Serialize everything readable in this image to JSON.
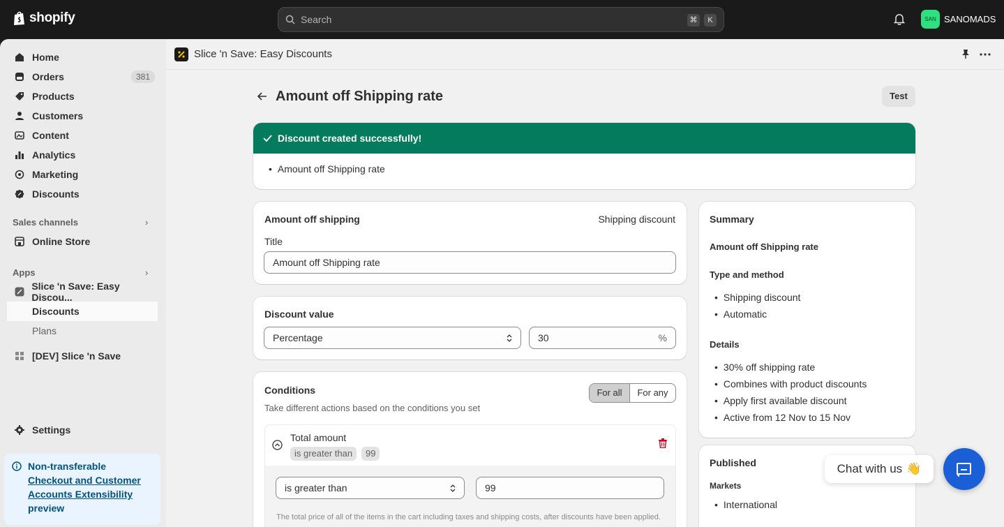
{
  "topbar": {
    "brand": "shopify",
    "search_placeholder": "Search",
    "shortcut_keys": [
      "⌘",
      "K"
    ],
    "store_initials": "SAN",
    "store_name": "SANOMADS"
  },
  "sidebar": {
    "items": [
      {
        "label": "Home",
        "icon": "home-icon"
      },
      {
        "label": "Orders",
        "icon": "orders-icon",
        "badge": "381"
      },
      {
        "label": "Products",
        "icon": "tag-icon"
      },
      {
        "label": "Customers",
        "icon": "person-icon"
      },
      {
        "label": "Content",
        "icon": "content-icon"
      },
      {
        "label": "Analytics",
        "icon": "chart-icon"
      },
      {
        "label": "Marketing",
        "icon": "target-icon"
      },
      {
        "label": "Discounts",
        "icon": "discount-icon"
      }
    ],
    "sales_channels_label": "Sales channels",
    "online_store": "Online Store",
    "apps_label": "Apps",
    "app_name": "Slice 'n Save: Easy Discou...",
    "app_sub_discounts": "Discounts",
    "app_sub_plans": "Plans",
    "dev_app": "[DEV] Slice 'n Save",
    "settings": "Settings",
    "notice": {
      "title": "Non-transferable",
      "link": "Checkout and Customer Accounts Extensibility",
      "suffix": "preview"
    }
  },
  "appbar": {
    "title": "Slice 'n Save: Easy Discounts"
  },
  "page": {
    "title": "Amount off Shipping rate",
    "test_button": "Test",
    "banner": {
      "title": "Discount created successfully!",
      "item": "Amount off Shipping rate"
    },
    "shipping_card": {
      "heading": "Amount off shipping",
      "type": "Shipping discount",
      "title_label": "Title",
      "title_value": "Amount off Shipping rate"
    },
    "value_card": {
      "heading": "Discount value",
      "type_value": "Percentage",
      "amount": "30",
      "suffix": "%"
    },
    "conditions": {
      "heading": "Conditions",
      "description": "Take different actions based on the conditions you set",
      "toggle": [
        "For all",
        "For any"
      ],
      "condition_title": "Total amount",
      "tag_operator": "is greater than",
      "tag_value": "99",
      "operator_value": "is greater than",
      "amount_value": "99",
      "help": "The total price of all of the items in the cart including taxes and shipping costs, after discounts have been applied."
    },
    "summary": {
      "heading": "Summary",
      "name": "Amount off Shipping rate",
      "type_heading": "Type and method",
      "type_items": [
        "Shipping discount",
        "Automatic"
      ],
      "details_heading": "Details",
      "details_items": [
        "30% off shipping rate",
        "Combines with product discounts",
        "Apply first available discount",
        "Active from 12 Nov to 15 Nov"
      ]
    },
    "published": {
      "heading": "Published",
      "markets_label": "Markets",
      "markets": [
        "International"
      ]
    },
    "chat": {
      "label": "Chat with us",
      "emoji": "👋"
    }
  },
  "colors": {
    "banner": "#047b5d",
    "chat": "#1a5fd6",
    "danger": "#c70a24"
  }
}
